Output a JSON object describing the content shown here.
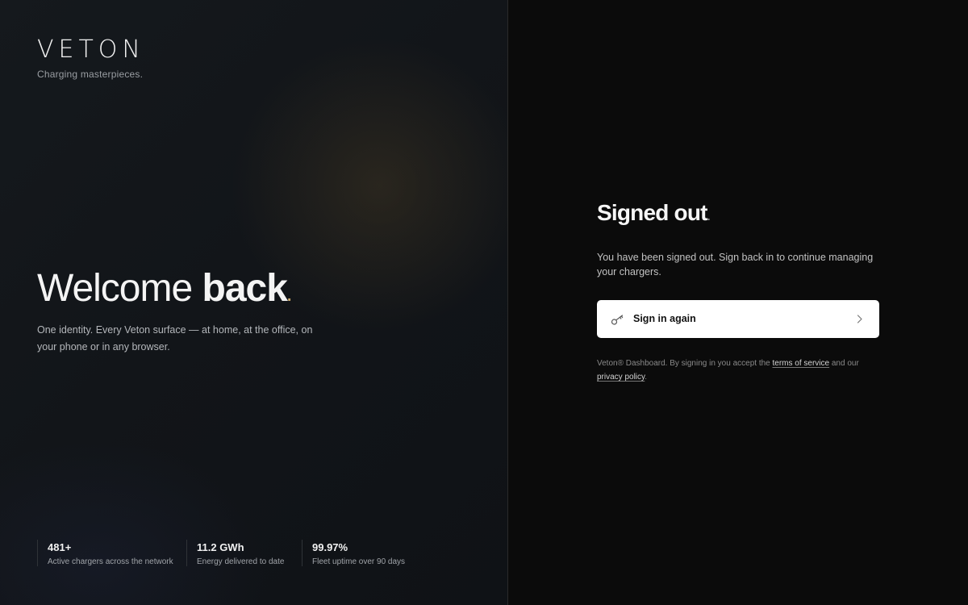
{
  "brand": {
    "logo": "VETON",
    "tagline": "Charging masterpieces."
  },
  "hero": {
    "title_light": "Welcome",
    "title_bold": "back",
    "title_dot": ".",
    "intro": "One identity. Every Veton surface — at home, at the office, on your phone or in any browser."
  },
  "stats": [
    {
      "value": "481+",
      "label": "Active chargers across the network"
    },
    {
      "value": "11.2 GWh",
      "label": "Energy delivered to date"
    },
    {
      "value": "99.97%",
      "label": "Fleet uptime over 90 days"
    }
  ],
  "signout": {
    "title": "Signed out",
    "title_dot": ".",
    "message": "You have been signed out. Sign back in to continue managing your chargers.",
    "button_label": "Sign in again",
    "button_icon": "key-icon",
    "legal_prefix": "Veton® Dashboard. By signing in you accept the ",
    "terms_link": "terms of service",
    "legal_middle": " and our ",
    "privacy_link": "privacy policy",
    "legal_suffix": "."
  },
  "colors": {
    "accent_dot": "#c9a86a",
    "button_bg": "#ffffff",
    "background": "#0b0b0b"
  }
}
